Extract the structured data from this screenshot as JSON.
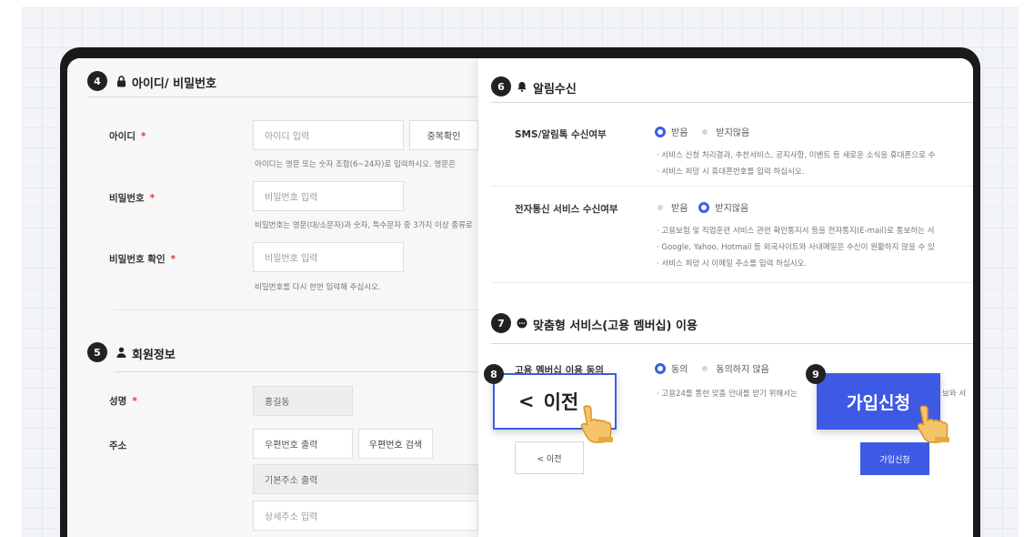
{
  "sections": {
    "account": {
      "step": "4",
      "title": "아이디/ 비밀번호"
    },
    "member": {
      "step": "5",
      "title": "회원정보"
    },
    "notify": {
      "step": "6",
      "title": "알림수신"
    },
    "custom": {
      "step": "7",
      "title": "맞춤형 서비스(고용 멤버십) 이용"
    }
  },
  "account": {
    "id_label": "아이디",
    "id_placeholder": "아이디 입력",
    "dup_check": "중복확인",
    "id_help": "아이디는 영문 또는 숫자 조합(6~24자)로 입력하시오. 영문은",
    "pw_label": "비밀번호",
    "pw_placeholder": "비밀번호 입력",
    "pw_help": "비밀번호는 영문(대/소문자)과 숫자, 특수문자 중 3가지 이상 종류로",
    "pw2_label": "비밀번호 확인",
    "pw2_placeholder": "비밀번호 입력",
    "pw2_help": "비밀번호를 다시 한번 입력해 주십시오.",
    "required_mark": "*"
  },
  "member": {
    "name_label": "성명",
    "name_value": "홍길동",
    "addr_label": "주소",
    "zip_value": "우편번호 출력",
    "zip_search": "우편번호 검색",
    "base_addr": "기본주소 출력",
    "detail_placeholder": "상세주소 입력"
  },
  "notify": {
    "sms_label": "SMS/알림톡 수신여부",
    "sms_yes": "받음",
    "sms_no": "받지않음",
    "sms_b1": "· 서비스 신청 처리결과, 추천서비스, 공지사항, 이벤트 등 새로운 소식을 휴대폰으로 수",
    "sms_b2": "· 서비스 희망 시 휴대폰번호를 입력 하십시오.",
    "email_label": "전자통신 서비스 수신여부",
    "email_yes": "받음",
    "email_no": "받지않음",
    "email_b1": "· 고용보험 및 직업훈련 서비스 관련 확인통지서 등을 전자통지(E-mail)로 통보하는 서",
    "email_b2": "· Google, Yahoo, Hotmail 등 외국사이트와 사내메일은 수신이 원활하지 않을 수 있",
    "email_b3": "· 서비스 희망 시 이메일 주소를 입력 하십시오."
  },
  "custom": {
    "label": "고용 멤버십 이용 동의",
    "agree": "동의",
    "disagree": "동의하지 않음",
    "b1_left": "· 고용24를 통한 맞춤 안내를 받기 위해서는",
    "b1_right": "보와 서"
  },
  "actions": {
    "prev_step": "8",
    "prev_big_arrow": "<",
    "prev_big": "이전",
    "prev_small": "< 이전",
    "join_step": "9",
    "join_big": "가입신청",
    "join_small": "가입신청"
  },
  "icons": {
    "lock": "lock-icon",
    "person": "person-icon",
    "bell": "bell-icon",
    "chat": "chat-icon",
    "pointer": "pointing-hand-icon"
  },
  "colors": {
    "accent": "#3e5ae4",
    "required": "#e33333"
  }
}
